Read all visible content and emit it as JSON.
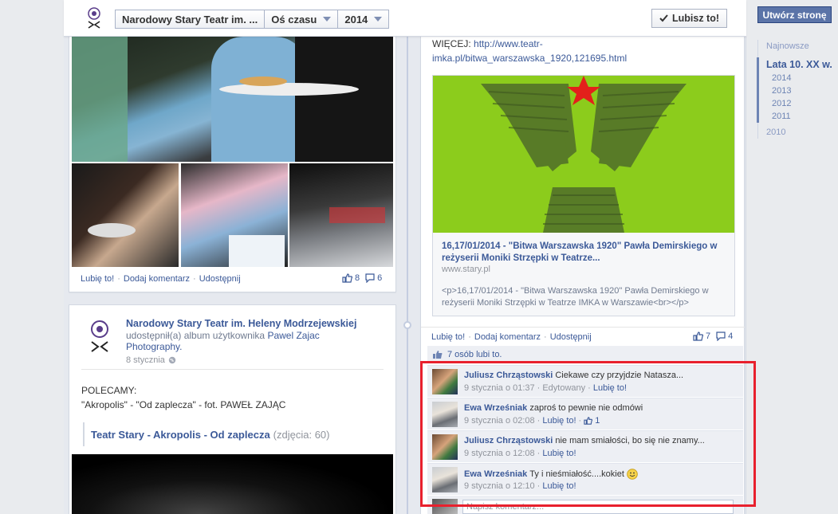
{
  "header": {
    "page_name": "Narodowy Stary Teatr im. ...",
    "view": "Oś czasu",
    "year": "2014",
    "like_button": "Lubisz to!"
  },
  "rail": {
    "create_page": "Utwórz stronę",
    "years": [
      "Najnowsze",
      "Lata 10. XX w.",
      "2014",
      "2013",
      "2012",
      "2011",
      "2010"
    ]
  },
  "post1": {
    "like": "Lubię to!",
    "comment": "Dodaj komentarz",
    "share": "Udostępnij",
    "likes": "8",
    "comments": "6"
  },
  "post2": {
    "author": "Narodowy Stary Teatr im. Heleny Modrzejewskiej",
    "shared_text": "udostępnił(a) album użytkownika",
    "shared_user": "Pawel Zajac Photography.",
    "date": "8 stycznia",
    "body_line1": "POLECAMY:",
    "body_line2": "\"Akropolis\" - \"Od zaplecza\" - fot. PAWEŁ ZAJĄC",
    "album_title": "Teatr Stary - Akropolis - Od zaplecza",
    "album_count": "(zdjęcia: 60)"
  },
  "post3": {
    "more_label": "WIĘCEJ:",
    "more_url_1": "http://www.teatr-",
    "more_url_2": "imka.pl/bitwa_warszawska_1920,121695.html",
    "link_title": "16,17/01/2014 - \"Bitwa Warszawska 1920\" Pawła Demirskiego w reżyserii Moniki Strzępki w Teatrze...",
    "link_domain": "www.stary.pl",
    "link_desc": "<p>16,17/01/2014 - \"Bitwa Warszawska 1920\" Pawła Demirskiego w reżyserii Moniki Strzępki w Teatrze IMKA w Warszawie<br></p>",
    "like": "Lubię to!",
    "comment": "Dodaj komentarz",
    "share": "Udostępnij",
    "likes": "7",
    "comments": "4",
    "likes_summary": "7 osób lubi to.",
    "write_comment": "Napisz komentarz..."
  },
  "comments": [
    {
      "author": "Juliusz Chrząstowski",
      "text": "Ciekawe czy przyjdzie Natasza...",
      "time": "9 stycznia o 01:37",
      "edited": "Edytowany",
      "like": "Lubię to!",
      "likes": ""
    },
    {
      "author": "Ewa Wrześniak",
      "text": "zaproś to pewnie nie odmówi",
      "time": "9 stycznia o 02:08",
      "edited": "",
      "like": "Lubię to!",
      "likes": "1"
    },
    {
      "author": "Juliusz Chrząstowski",
      "text": "nie mam smiałości, bo się nie znamy...",
      "time": "9 stycznia o 12:08",
      "edited": "",
      "like": "Lubię to!",
      "likes": ""
    },
    {
      "author": "Ewa Wrześniak",
      "text": "Ty i nieśmiałość....kokiet",
      "time": "9 stycznia o 12:10",
      "edited": "",
      "like": "Lubię to!",
      "likes": ""
    }
  ],
  "colors": {
    "accent": "#3b5998",
    "highlight": "#e8202d",
    "green": "#8ccc1c",
    "star": "#e3201b"
  }
}
